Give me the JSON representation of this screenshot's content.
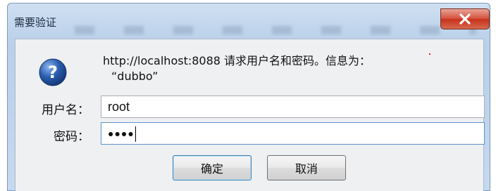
{
  "dialog": {
    "title": "需要验证",
    "message_line1": "http://localhost:8088 请求用户名和密码。信息为：",
    "message_line2": "“dubbo”",
    "username_label": "用户名：",
    "username_value": "root",
    "password_label": "密码：",
    "password_mask": "●●●●",
    "ok_label": "确定",
    "cancel_label": "取消"
  },
  "icons": {
    "help": "question-mark-icon",
    "close": "close-x-icon"
  },
  "colors": {
    "close_button": "#d5523e",
    "help_icon": "#2a5db0"
  }
}
